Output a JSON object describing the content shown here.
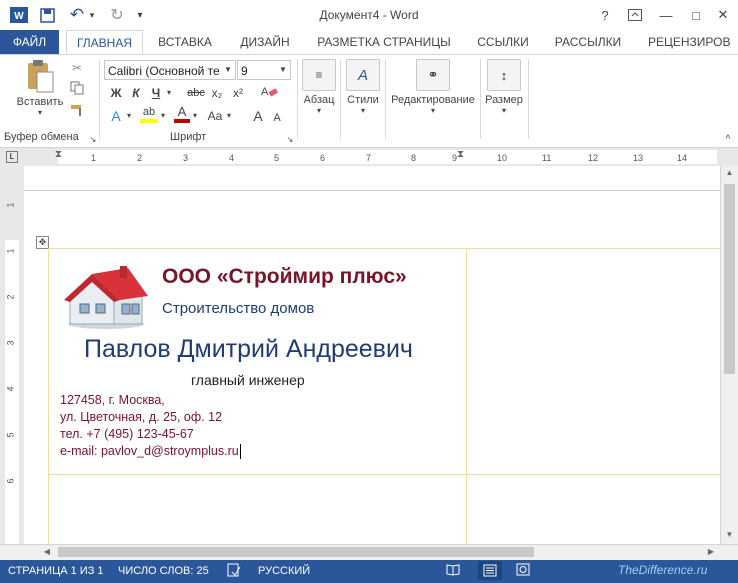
{
  "window": {
    "title": "Документ4 - Word",
    "controls": {
      "help": "?",
      "minimize": "—",
      "maximize": "□",
      "close": "✕"
    }
  },
  "quick_access": {
    "word_icon": "W",
    "save": "💾",
    "undo": "↶",
    "redo": "↻",
    "customize": "▾"
  },
  "tabs": [
    {
      "label": "ФАЙЛ"
    },
    {
      "label": "ГЛАВНАЯ"
    },
    {
      "label": "ВСТАВКА"
    },
    {
      "label": "ДИЗАЙН"
    },
    {
      "label": "РАЗМЕТКА СТРАНИЦЫ"
    },
    {
      "label": "ССЫЛКИ"
    },
    {
      "label": "РАССЫЛКИ"
    },
    {
      "label": "РЕЦЕНЗИРОВ"
    }
  ],
  "ribbon": {
    "clipboard": {
      "paste_label": "Вставить",
      "group_label": "Буфер обмена"
    },
    "font": {
      "font_name": "Calibri (Основной те",
      "font_size": "9",
      "bold": "Ж",
      "italic": "К",
      "underline": "Ч",
      "strike": "abc",
      "subscript": "x₂",
      "superscript": "x²",
      "text_effects": "A",
      "highlight": "ab",
      "font_color": "A",
      "case": "Aa",
      "grow": "A",
      "shrink": "A",
      "group_label": "Шрифт"
    },
    "paragraph_label": "Абзац",
    "styles_label": "Стили",
    "editing_label": "Редактирование",
    "size_label": "Размер"
  },
  "ruler": {
    "h_ticks": [
      "1",
      "2",
      "3",
      "4",
      "5",
      "6",
      "7",
      "8",
      "9",
      "10",
      "11",
      "12",
      "13",
      "14"
    ],
    "v_ticks": [
      "1",
      "1",
      "2",
      "3",
      "4",
      "5",
      "6"
    ]
  },
  "card": {
    "company": "ООО «Строймир плюс»",
    "tagline": "Строительство домов",
    "person_name": "Павлов Дмитрий Андреевич",
    "position": "главный инженер",
    "address_line1": "127458, г. Москва,",
    "address_line2": "ул. Цветочная, д. 25, оф. 12",
    "phone": "тел. +7 (495) 123-45-67",
    "email": "e-mail: pavlov_d@stroymplus.ru"
  },
  "status": {
    "page": "СТРАНИЦА 1 ИЗ 1",
    "words": "ЧИСЛО СЛОВ: 25",
    "language": "РУССКИЙ",
    "watermark": "TheDifference.ru"
  },
  "colors": {
    "accent": "#2b579a",
    "company_red": "#7a1428",
    "name_blue": "#1f3d73",
    "address_red": "#7a1428"
  }
}
